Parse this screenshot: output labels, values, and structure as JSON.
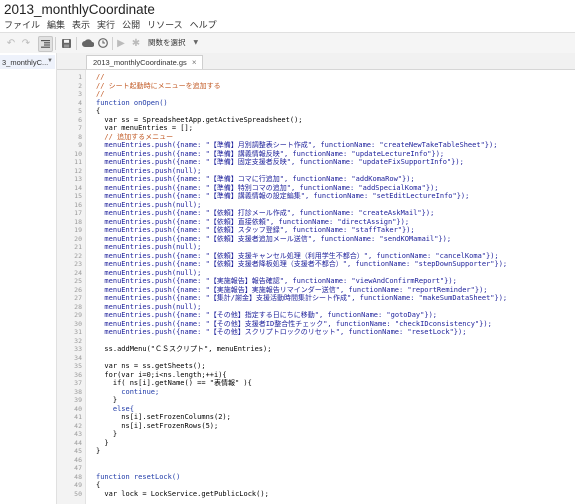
{
  "app": {
    "title": "2013_monthlyCoordinate",
    "menu": [
      "ファイル",
      "編集",
      "表示",
      "実行",
      "公開",
      "リソース",
      "ヘルプ"
    ],
    "function_select": "関数を選択"
  },
  "sidebar": {
    "file_label": "3_monthlyC..."
  },
  "tabs": [
    {
      "label": "2013_monthlyCoordinate.gs",
      "close": "×"
    }
  ],
  "editor": {
    "lines": [
      {
        "n": "1",
        "text": "//",
        "cls": "c-cmt"
      },
      {
        "n": "2",
        "text": "// シート起動時にメニューを追加する",
        "cls": "c-cmt"
      },
      {
        "n": "3",
        "text": "//",
        "cls": "c-cmt"
      },
      {
        "n": "4",
        "text": "function onOpen()",
        "cls": "c-kw"
      },
      {
        "n": "5",
        "text": "{",
        "cls": ""
      },
      {
        "n": "6",
        "text": "  var ss = SpreadsheetApp.getActiveSpreadsheet();",
        "cls": ""
      },
      {
        "n": "7",
        "text": "  var menuEntries = [];",
        "cls": ""
      },
      {
        "n": "8",
        "text": "  // 追加するメニュー",
        "cls": "c-cmt"
      },
      {
        "n": "9",
        "text": "  menuEntries.push({name: \"【準備】月別調整表シート作成\", functionName: \"createNewTakeTableSheet\"});",
        "cls": "c-var"
      },
      {
        "n": "10",
        "text": "  menuEntries.push({name: \"【準備】講義情報反映\", functionName: \"updateLectureInfo\"});",
        "cls": "c-var"
      },
      {
        "n": "11",
        "text": "  menuEntries.push({name: \"【準備】固定支援者反映\", functionName: \"updateFixSupportInfo\"});",
        "cls": "c-var"
      },
      {
        "n": "12",
        "text": "  menuEntries.push(null);",
        "cls": "c-var"
      },
      {
        "n": "13",
        "text": "  menuEntries.push({name: \"【準備】コマに行追加\", functionName: \"addKomaRow\"});",
        "cls": "c-var"
      },
      {
        "n": "14",
        "text": "  menuEntries.push({name: \"【準備】特別コマの追加\", functionName: \"addSpecialKoma\"});",
        "cls": "c-var"
      },
      {
        "n": "15",
        "text": "  menuEntries.push({name: \"【準備】講義情報の設定編集\", functionName: \"setEditLectureInfo\"});",
        "cls": "c-var"
      },
      {
        "n": "16",
        "text": "  menuEntries.push(null);",
        "cls": "c-var"
      },
      {
        "n": "17",
        "text": "  menuEntries.push({name: \"【依頼】打診メール作成\", functionName: \"createAskMail\"});",
        "cls": "c-var"
      },
      {
        "n": "18",
        "text": "  menuEntries.push({name: \"【依頼】直接依頼\", functionName: \"directAssign\"});",
        "cls": "c-var"
      },
      {
        "n": "19",
        "text": "  menuEntries.push({name: \"【依頼】スタッフ登録\", functionName: \"staffTaker\"});",
        "cls": "c-var"
      },
      {
        "n": "20",
        "text": "  menuEntries.push({name: \"【依頼】支援者追加メール送信\", functionName: \"sendKOMamail\"});",
        "cls": "c-var"
      },
      {
        "n": "21",
        "text": "  menuEntries.push(null);",
        "cls": "c-var"
      },
      {
        "n": "22",
        "text": "  menuEntries.push({name: \"【依頼】支援キャンセル処理（利用学生不都合）\", functionName: \"cancelKoma\"});",
        "cls": "c-var"
      },
      {
        "n": "23",
        "text": "  menuEntries.push({name: \"【依頼】支援者降板処理（支援者不都合）\", functionName: \"stepDownSupporter\"});",
        "cls": "c-var"
      },
      {
        "n": "24",
        "text": "  menuEntries.push(null);",
        "cls": "c-var"
      },
      {
        "n": "25",
        "text": "  menuEntries.push({name: \"【実施報告】報告確認\", functionName: \"viewAndConfirmReport\"});",
        "cls": "c-var"
      },
      {
        "n": "26",
        "text": "  menuEntries.push({name: \"【実施報告】実施報告リマインダー送信\", functionName: \"reportReminder\"});",
        "cls": "c-var"
      },
      {
        "n": "27",
        "text": "  menuEntries.push({name: \"【集計/謝金】支援活動時間集計シート作成\", functionName: \"makeSumDataSheet\"});",
        "cls": "c-var"
      },
      {
        "n": "28",
        "text": "  menuEntries.push(null);",
        "cls": "c-var"
      },
      {
        "n": "29",
        "text": "  menuEntries.push({name: \"【その他】指定する日にちに移動\", functionName: \"gotoDay\"});",
        "cls": "c-var"
      },
      {
        "n": "30",
        "text": "  menuEntries.push({name: \"【その他】支援者ID整合性チェック\", functionName: \"checkIDconsistency\"});",
        "cls": "c-var"
      },
      {
        "n": "31",
        "text": "  menuEntries.push({name: \"【その他】スクリプトロックのリセット\", functionName: \"resetLock\"});",
        "cls": "c-var"
      },
      {
        "n": "32",
        "text": "",
        "cls": ""
      },
      {
        "n": "33",
        "text": "  ss.addMenu(\"ＣＳスクリプト\", menuEntries);",
        "cls": ""
      },
      {
        "n": "34",
        "text": "",
        "cls": ""
      },
      {
        "n": "35",
        "text": "  var ns = ss.getSheets();",
        "cls": ""
      },
      {
        "n": "36",
        "text": "  for(var i=0;i<ns.length;++i){",
        "cls": ""
      },
      {
        "n": "37",
        "text": "    if( ns[i].getName() == \"表情報\" ){",
        "cls": ""
      },
      {
        "n": "38",
        "text": "      continue;",
        "cls": "c-kw"
      },
      {
        "n": "39",
        "text": "    }",
        "cls": ""
      },
      {
        "n": "40",
        "text": "    else{",
        "cls": "c-kw"
      },
      {
        "n": "41",
        "text": "      ns[i].setFrozenColumns(2);",
        "cls": ""
      },
      {
        "n": "42",
        "text": "      ns[i].setFrozenRows(5);",
        "cls": ""
      },
      {
        "n": "43",
        "text": "    }",
        "cls": ""
      },
      {
        "n": "44",
        "text": "  }",
        "cls": ""
      },
      {
        "n": "45",
        "text": "}",
        "cls": ""
      },
      {
        "n": "46",
        "text": "",
        "cls": ""
      },
      {
        "n": "47",
        "text": "",
        "cls": ""
      },
      {
        "n": "48",
        "text": "function resetLock()",
        "cls": "c-kw"
      },
      {
        "n": "49",
        "text": "{",
        "cls": ""
      },
      {
        "n": "50",
        "text": "  var lock = LockService.getPublicLock();",
        "cls": ""
      }
    ]
  }
}
